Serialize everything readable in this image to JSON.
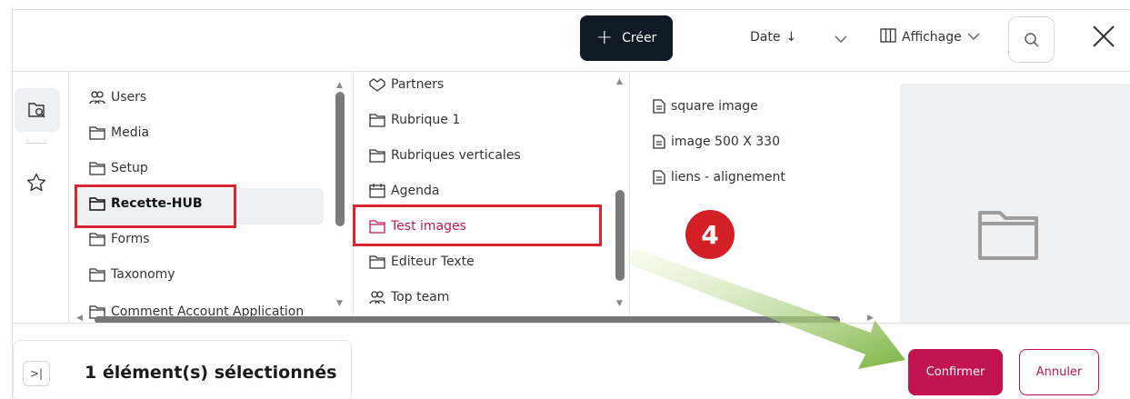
{
  "toolbar": {
    "create_label": "Créer",
    "sort_label": "Date",
    "sort_arrow": "↓",
    "display_label": "Affichage"
  },
  "column1": {
    "items": [
      {
        "label": "Users",
        "icon": "users-icon"
      },
      {
        "label": "Media",
        "icon": "folder-icon"
      },
      {
        "label": "Setup",
        "icon": "folder-icon"
      },
      {
        "label": "Recette-HUB",
        "icon": "folder-icon"
      },
      {
        "label": "Forms",
        "icon": "folder-icon"
      },
      {
        "label": "Taxonomy",
        "icon": "folder-icon"
      },
      {
        "label": "Comment Account Application",
        "icon": "folder-icon"
      }
    ]
  },
  "column2": {
    "items": [
      {
        "label": "Partners",
        "icon": "handshake-icon"
      },
      {
        "label": "Rubrique 1",
        "icon": "folder-icon"
      },
      {
        "label": "Rubriques verticales",
        "icon": "folder-icon"
      },
      {
        "label": "Agenda",
        "icon": "calendar-icon"
      },
      {
        "label": "Test images",
        "icon": "folder-icon"
      },
      {
        "label": "Editeur Texte",
        "icon": "folder-icon"
      },
      {
        "label": "Top team",
        "icon": "users-icon"
      }
    ]
  },
  "column3": {
    "items": [
      {
        "label": "square image",
        "icon": "document-icon"
      },
      {
        "label": "image 500 X 330",
        "icon": "document-icon"
      },
      {
        "label": "liens - alignement",
        "icon": "document-icon"
      }
    ]
  },
  "annotation": {
    "step_number": "4"
  },
  "footer": {
    "expand_label": ">|",
    "selection_text": "1 élément(s) sélectionnés",
    "confirm_label": "Confirmer",
    "cancel_label": "Annuler"
  },
  "colors": {
    "accent": "#c0134f",
    "dark_button": "#0f1a24",
    "highlight_box": "#d9262e",
    "arrow": "#8bc34a"
  }
}
